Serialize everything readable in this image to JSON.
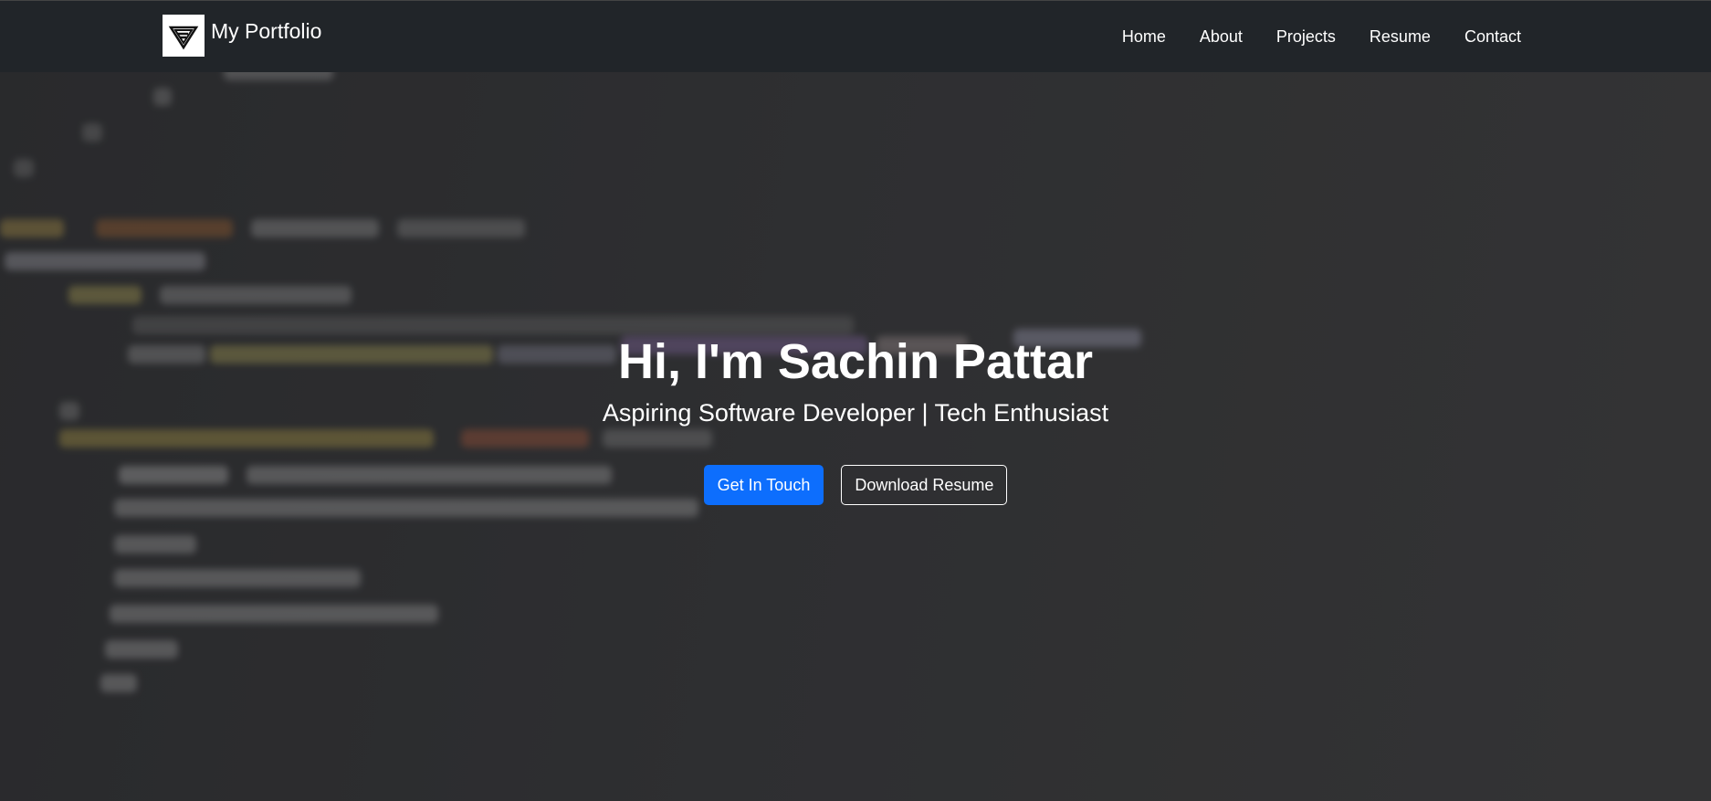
{
  "navbar": {
    "brand": "My Portfolio",
    "logo_icon": "portfolio-logo-icon",
    "links": [
      "Home",
      "About",
      "Projects",
      "Resume",
      "Contact"
    ]
  },
  "hero": {
    "title": "Hi, I'm Sachin Pattar",
    "subtitle": "Aspiring Software Developer | Tech Enthusiast",
    "primary_button": "Get In Touch",
    "secondary_button": "Download Resume"
  },
  "colors": {
    "navbar_bg": "#212529",
    "primary": "#0d6efd",
    "hero_text": "#ffffff"
  }
}
